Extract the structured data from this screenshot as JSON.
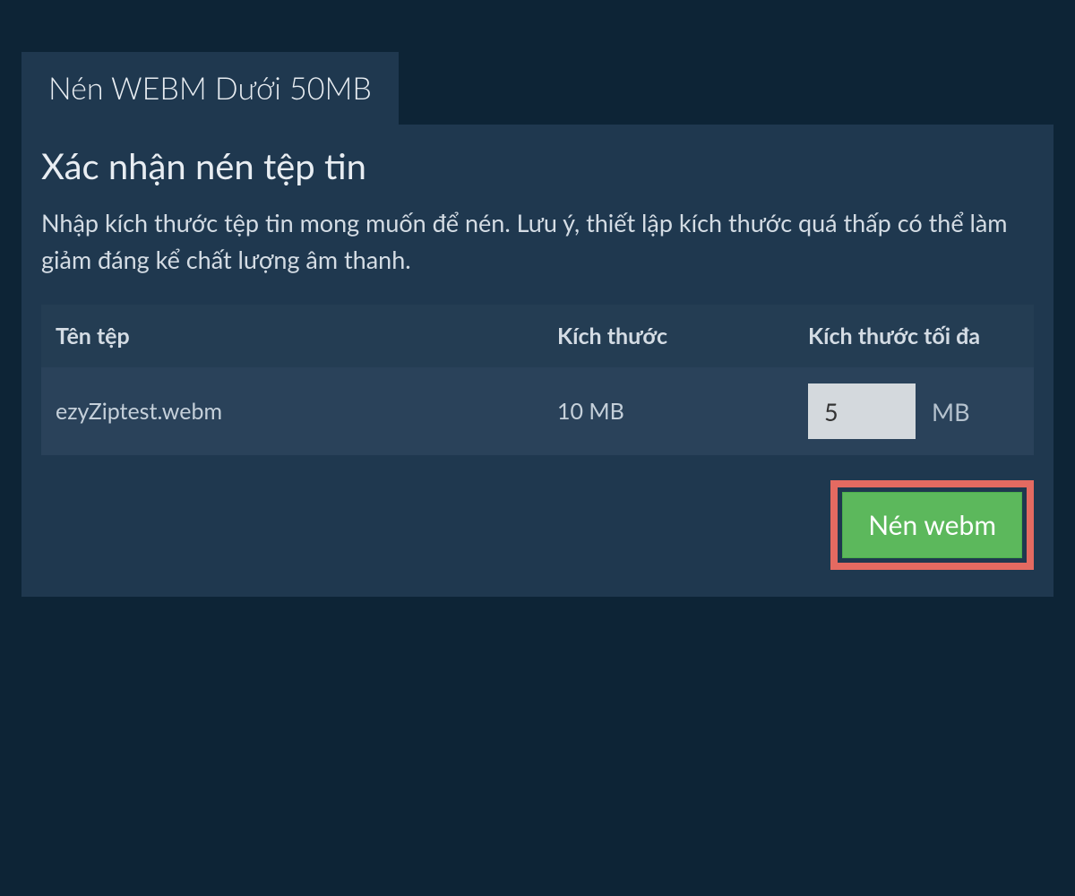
{
  "tab": {
    "label": "Nén WEBM Dưới 50MB"
  },
  "heading": "Xác nhận nén tệp tin",
  "description": "Nhập kích thước tệp tin mong muốn để nén. Lưu ý, thiết lập kích thước quá thấp có thể làm giảm đáng kể chất lượng âm thanh.",
  "table": {
    "headers": {
      "filename": "Tên tệp",
      "size": "Kích thước",
      "maxsize": "Kích thước tối đa"
    },
    "rows": [
      {
        "filename": "ezyZiptest.webm",
        "size": "10 MB",
        "maxsize_value": "5",
        "maxsize_unit": "MB"
      }
    ]
  },
  "compress_button": {
    "label": "Nén webm"
  }
}
